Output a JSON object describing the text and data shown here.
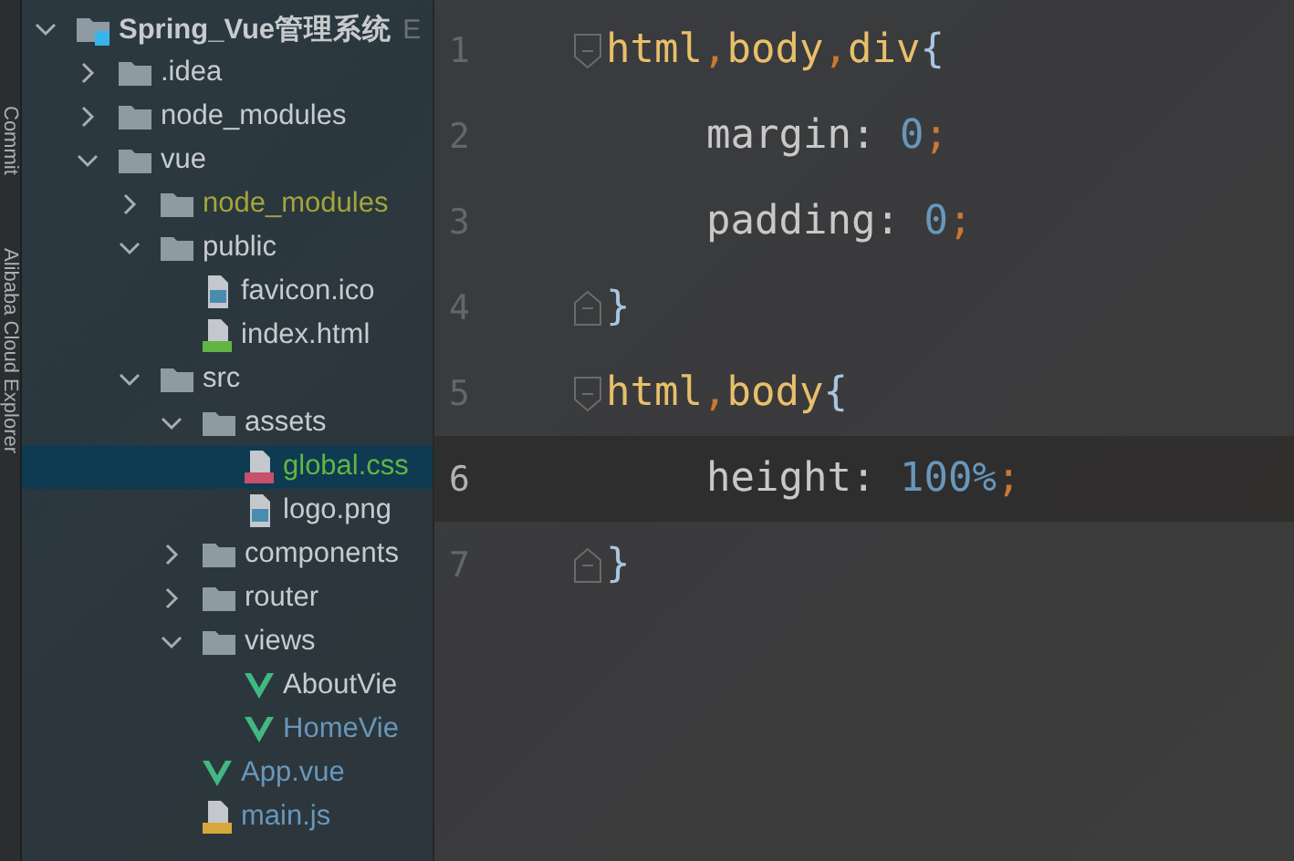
{
  "tool_strip": {
    "labels": [
      "Commit",
      "Alibaba Cloud Explorer"
    ]
  },
  "project_tree": [
    {
      "name": "Spring_Vue管理系统",
      "kind": "project",
      "expanded": true,
      "selected": false,
      "color": "#c7cbce",
      "hint": "E",
      "children": [
        {
          "name": ".idea",
          "kind": "folder",
          "expanded": false,
          "selected": false,
          "color": "#c7cbce"
        },
        {
          "name": "node_modules",
          "kind": "folder",
          "expanded": false,
          "selected": false,
          "color": "#c7cbce"
        },
        {
          "name": "vue",
          "kind": "folder",
          "expanded": true,
          "selected": false,
          "color": "#c7cbce",
          "children": [
            {
              "name": "node_modules",
              "kind": "folder",
              "expanded": false,
              "selected": false,
              "color": "#a3a53a"
            },
            {
              "name": "public",
              "kind": "folder",
              "expanded": true,
              "selected": false,
              "color": "#c7cbce",
              "children": [
                {
                  "name": "favicon.ico",
                  "kind": "image",
                  "selected": false,
                  "color": "#c7cbce"
                },
                {
                  "name": "index.html",
                  "kind": "html",
                  "selected": false,
                  "color": "#c7cbce"
                }
              ]
            },
            {
              "name": "src",
              "kind": "folder",
              "expanded": true,
              "selected": false,
              "color": "#c7cbce",
              "children": [
                {
                  "name": "assets",
                  "kind": "folder",
                  "expanded": true,
                  "selected": false,
                  "color": "#c7cbce",
                  "children": [
                    {
                      "name": "global.css",
                      "kind": "css",
                      "selected": true,
                      "color": "#62b543"
                    },
                    {
                      "name": "logo.png",
                      "kind": "image",
                      "selected": false,
                      "color": "#c7cbce"
                    }
                  ]
                },
                {
                  "name": "components",
                  "kind": "folder",
                  "expanded": false,
                  "selected": false,
                  "color": "#c7cbce"
                },
                {
                  "name": "router",
                  "kind": "folder",
                  "expanded": false,
                  "selected": false,
                  "color": "#c7cbce"
                },
                {
                  "name": "views",
                  "kind": "folder",
                  "expanded": true,
                  "selected": false,
                  "color": "#c7cbce",
                  "children": [
                    {
                      "name": "AboutVie",
                      "kind": "vue",
                      "selected": false,
                      "color": "#c7cbce"
                    },
                    {
                      "name": "HomeVie",
                      "kind": "vue",
                      "selected": false,
                      "color": "#6897bb"
                    }
                  ]
                },
                {
                  "name": "App.vue",
                  "kind": "vue",
                  "selected": false,
                  "color": "#6897bb"
                },
                {
                  "name": "main.js",
                  "kind": "js",
                  "selected": false,
                  "color": "#6897bb"
                }
              ]
            }
          ]
        }
      ]
    }
  ],
  "editor": {
    "lines": [
      {
        "number": "1",
        "current": false,
        "kind": "fold-start",
        "indented": false,
        "tokens": [
          {
            "kind": "selector",
            "text": "html",
            "sep": ","
          },
          {
            "kind": "selector",
            "text": "body",
            "sep": ","
          },
          {
            "kind": "selector",
            "text": "div"
          },
          {
            "kind": "brace",
            "text": "{"
          }
        ]
      },
      {
        "number": "2",
        "current": false,
        "kind": "plain",
        "indented": true,
        "tokens": [
          {
            "kind": "property",
            "text": "margin: "
          },
          {
            "kind": "number",
            "text": "0"
          },
          {
            "kind": "punct",
            "text": ";"
          }
        ]
      },
      {
        "number": "3",
        "current": false,
        "kind": "plain",
        "indented": true,
        "tokens": [
          {
            "kind": "property",
            "text": "padding: "
          },
          {
            "kind": "number",
            "text": "0"
          },
          {
            "kind": "punct",
            "text": ";"
          }
        ]
      },
      {
        "number": "4",
        "current": false,
        "kind": "fold-end",
        "indented": false,
        "tokens": [
          {
            "kind": "brace",
            "text": "}"
          }
        ]
      },
      {
        "number": "5",
        "current": false,
        "kind": "fold-start",
        "indented": false,
        "tokens": [
          {
            "kind": "selector",
            "text": "html",
            "sep": ","
          },
          {
            "kind": "selector",
            "text": "body"
          },
          {
            "kind": "brace",
            "text": "{"
          }
        ]
      },
      {
        "number": "6",
        "current": true,
        "kind": "plain",
        "indented": true,
        "tokens": [
          {
            "kind": "property",
            "text": "height: "
          },
          {
            "kind": "number",
            "text": "100%"
          },
          {
            "kind": "punct",
            "text": ";"
          }
        ]
      },
      {
        "number": "7",
        "current": false,
        "kind": "fold-end",
        "indented": false,
        "tokens": [
          {
            "kind": "brace",
            "text": "}"
          }
        ]
      }
    ]
  }
}
